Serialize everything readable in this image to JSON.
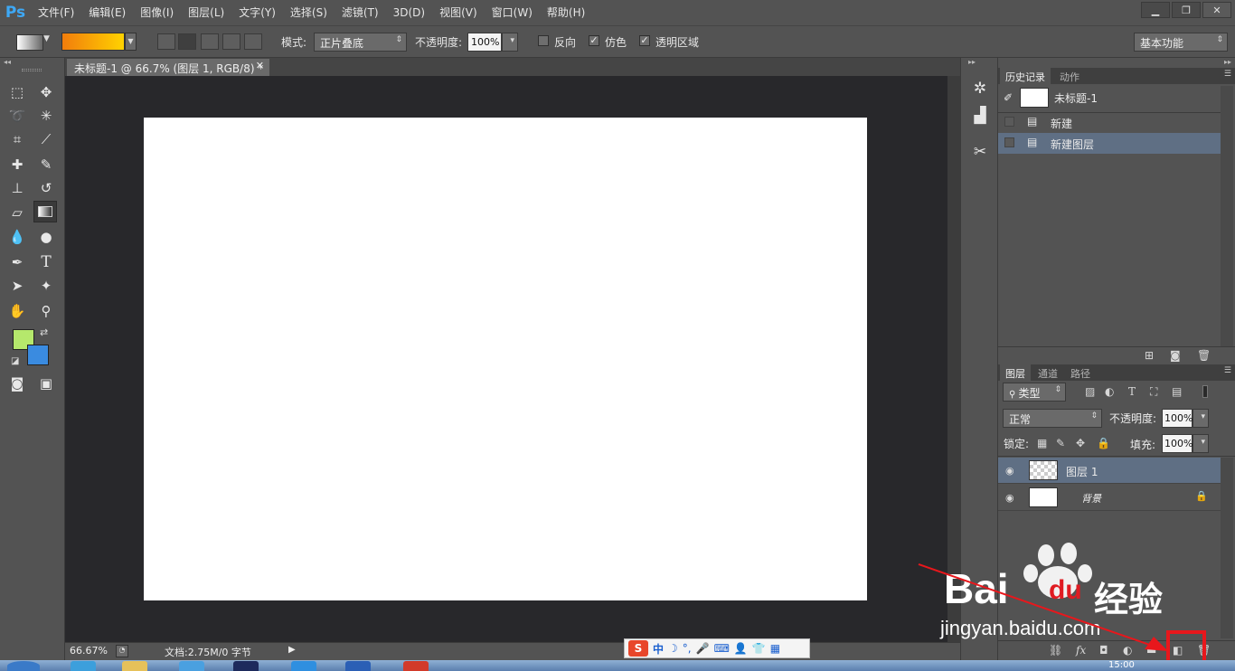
{
  "app": {
    "logo": "Ps"
  },
  "menu": [
    "文件(F)",
    "编辑(E)",
    "图像(I)",
    "图层(L)",
    "文字(Y)",
    "选择(S)",
    "滤镜(T)",
    "3D(D)",
    "视图(V)",
    "窗口(W)",
    "帮助(H)"
  ],
  "window_buttons": {
    "minimize": "▁",
    "restore": "❐",
    "close": "✕"
  },
  "options": {
    "mode_label": "模式:",
    "mode_value": "正片叠底",
    "opacity_label": "不透明度:",
    "opacity_value": "100%",
    "reverse_label": "反向",
    "dither_label": "仿色",
    "transparency_label": "透明区域",
    "workspace": "基本功能",
    "gradient_colors": [
      "#f27d0c",
      "#ffd200"
    ]
  },
  "colors": {
    "foreground": "#b5e86c",
    "background": "#3a8be0",
    "canvas_bg": "#28282b",
    "accent_selection": "#5f6f84"
  },
  "document": {
    "tab_title": "未标题-1 @ 66.7% (图层 1, RGB/8) *",
    "zoom": "66.67%",
    "doc_info": "文档:2.75M/0 字节"
  },
  "history": {
    "tabs": [
      "历史记录",
      "动作"
    ],
    "snapshot_name": "未标题-1",
    "items": [
      "新建",
      "新建图层"
    ]
  },
  "layers": {
    "tabs": [
      "图层",
      "通道",
      "路径"
    ],
    "filter_kind": "类型",
    "blend_mode": "正常",
    "opacity_label": "不透明度:",
    "opacity_value": "100%",
    "lock_label": "锁定:",
    "fill_label": "填充:",
    "fill_value": "100%",
    "items": [
      {
        "name": "图层 1",
        "selected": true
      },
      {
        "name": "背景",
        "selected": false
      }
    ]
  },
  "ime": {
    "lang": "中"
  },
  "watermark": {
    "brand": "Bai",
    "brand2": "du",
    "cn": "经验",
    "url": "jingyan.baidu.com"
  },
  "taskbar": {
    "time": "15:00"
  }
}
